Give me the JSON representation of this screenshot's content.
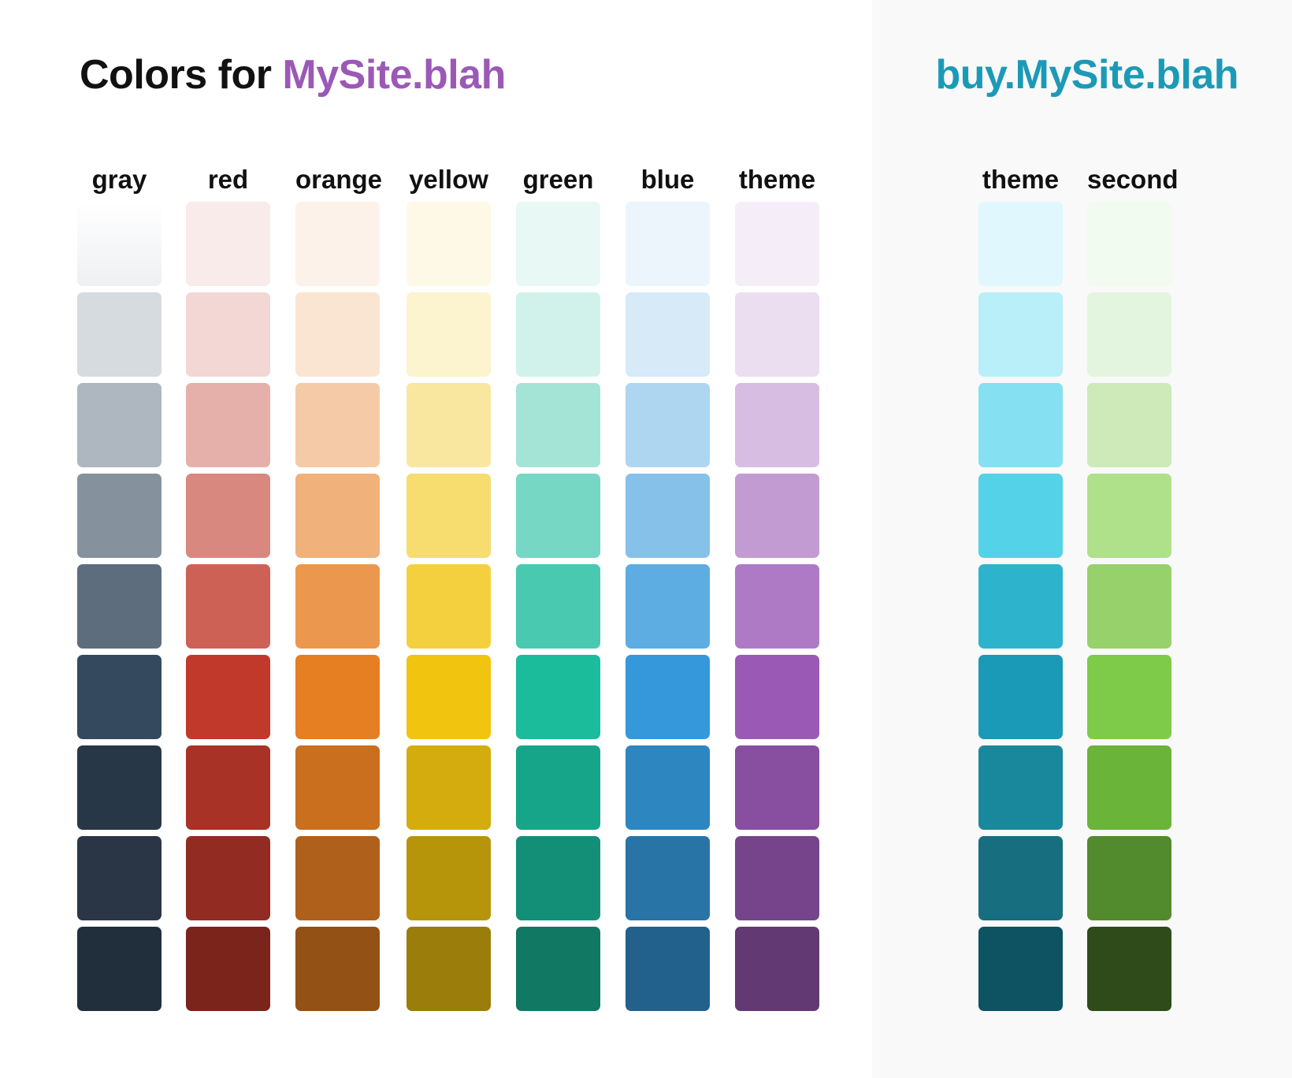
{
  "header": {
    "prefix": "Colors for ",
    "site_name": "MySite.blah",
    "site_color": "#9b59b6",
    "secondary_site": "buy.MySite.blah",
    "secondary_color": "#1b9ab7"
  },
  "palette_groups": [
    {
      "name": "main",
      "background": "#ffffff",
      "columns": [
        {
          "label": "gray",
          "swatches": [
            "#f6f7f8",
            "#d6dbdf",
            "#aeb6bf",
            "#85929e",
            "#5d6d7e",
            "#34495e",
            "#283747",
            "#2a3646",
            "#212f3c"
          ]
        },
        {
          "label": "red",
          "swatches": [
            "#f9ebea",
            "#f2d7d5",
            "#e6b0aa",
            "#d98880",
            "#cd6155",
            "#c0392b",
            "#a93226",
            "#922b21",
            "#7b241c"
          ]
        },
        {
          "label": "orange",
          "swatches": [
            "#fdf2e9",
            "#fae5d3",
            "#f5cba7",
            "#f0b27a",
            "#eb984e",
            "#e67e22",
            "#ca6f1e",
            "#af601a",
            "#935116"
          ]
        },
        {
          "label": "yellow",
          "swatches": [
            "#fef9e7",
            "#fcf3cf",
            "#f9e79f",
            "#f7dc6f",
            "#f4d03f",
            "#f1c40f",
            "#d4ac0d",
            "#b7950b",
            "#9a7d0a"
          ]
        },
        {
          "label": "green",
          "swatches": [
            "#e8f8f5",
            "#d1f2eb",
            "#a3e4d7",
            "#76d7c4",
            "#48c9b0",
            "#1abc9c",
            "#17a589",
            "#148f77",
            "#117864"
          ]
        },
        {
          "label": "blue",
          "swatches": [
            "#ebf5fb",
            "#d6eaf8",
            "#aed6f1",
            "#85c1e9",
            "#5dade2",
            "#3498db",
            "#2e86c1",
            "#2874a6",
            "#21618c"
          ]
        },
        {
          "label": "theme",
          "swatches": [
            "#f5eef8",
            "#ebdef0",
            "#d7bde2",
            "#c39bd3",
            "#af7ac5",
            "#9b59b6",
            "#884ea0",
            "#76448a",
            "#633974"
          ]
        }
      ]
    },
    {
      "name": "buy-site",
      "background": "#f9f9f9",
      "columns": [
        {
          "label": "theme",
          "swatches": [
            "#e0f7fd",
            "#b9eff9",
            "#85e1f2",
            "#54d2e8",
            "#2db4cc",
            "#1b9ab7",
            "#1a889c",
            "#176e7f",
            "#0d5361"
          ]
        },
        {
          "label": "second",
          "swatches": [
            "#f2fbef",
            "#e4f5df",
            "#cdeab8",
            "#afe08a",
            "#96d16b",
            "#7ecb49",
            "#6ab43a",
            "#528a2e",
            "#2f4b1a"
          ]
        }
      ]
    }
  ]
}
